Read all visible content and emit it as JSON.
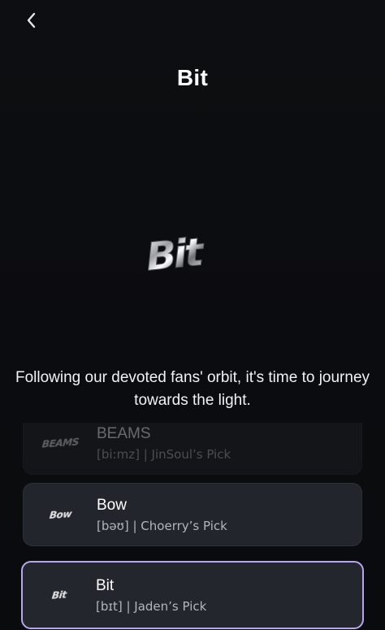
{
  "header": {
    "back_icon": "chevron-left-icon",
    "title": "Bit"
  },
  "hero": {
    "logo_text": "Bit"
  },
  "description": "Following our devoted fans' orbit, it's time to journey towards the light.",
  "items": [
    {
      "logo_text": "BEAMS",
      "title": "BEAMS",
      "subtitle": "[bi:mz] | JinSoul’s Pick",
      "state": "faded"
    },
    {
      "logo_text": "Bow",
      "title": "Bow",
      "subtitle": "[bəʊ] | Choerry’s Pick",
      "state": "normal"
    },
    {
      "logo_text": "Bit",
      "title": "Bit",
      "subtitle": "[bɪt] | Jaden’s Pick",
      "state": "selected"
    }
  ],
  "colors": {
    "background": "#0b0c0f",
    "card": "#22252b",
    "selected_border": "#b7a6ef",
    "subtitle": "#b3b6bd"
  }
}
